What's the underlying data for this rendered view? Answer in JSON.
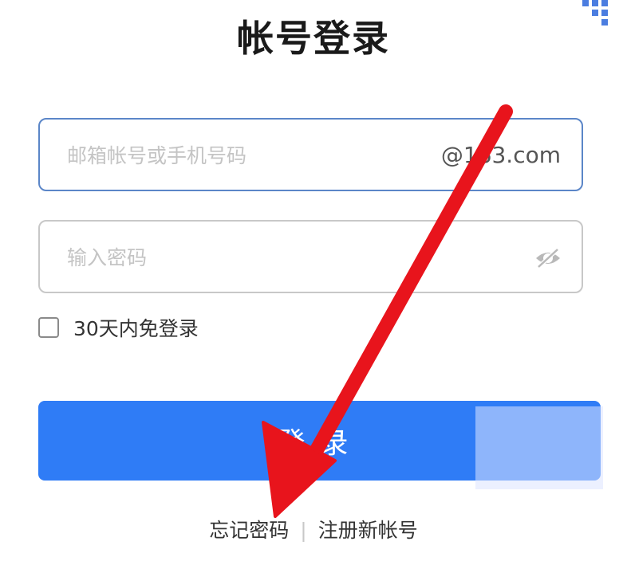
{
  "title": "帐号登录",
  "account": {
    "placeholder": "邮箱帐号或手机号码",
    "value": "",
    "suffix": "@163.com"
  },
  "password": {
    "placeholder": "输入密码",
    "value": ""
  },
  "remember": {
    "label": "30天内免登录",
    "checked": false
  },
  "login_button": {
    "label": "登录"
  },
  "links": {
    "forgot": "忘记密码",
    "separator": "|",
    "register": "注册新帐号"
  },
  "colors": {
    "primary": "#2f7cf6",
    "arrow": "#e8141c",
    "focus_border": "#5b86c8"
  },
  "icons": {
    "password_toggle": "eye-hidden-icon",
    "corner": "qr-code-icon",
    "annotation": "red-arrow-icon"
  }
}
